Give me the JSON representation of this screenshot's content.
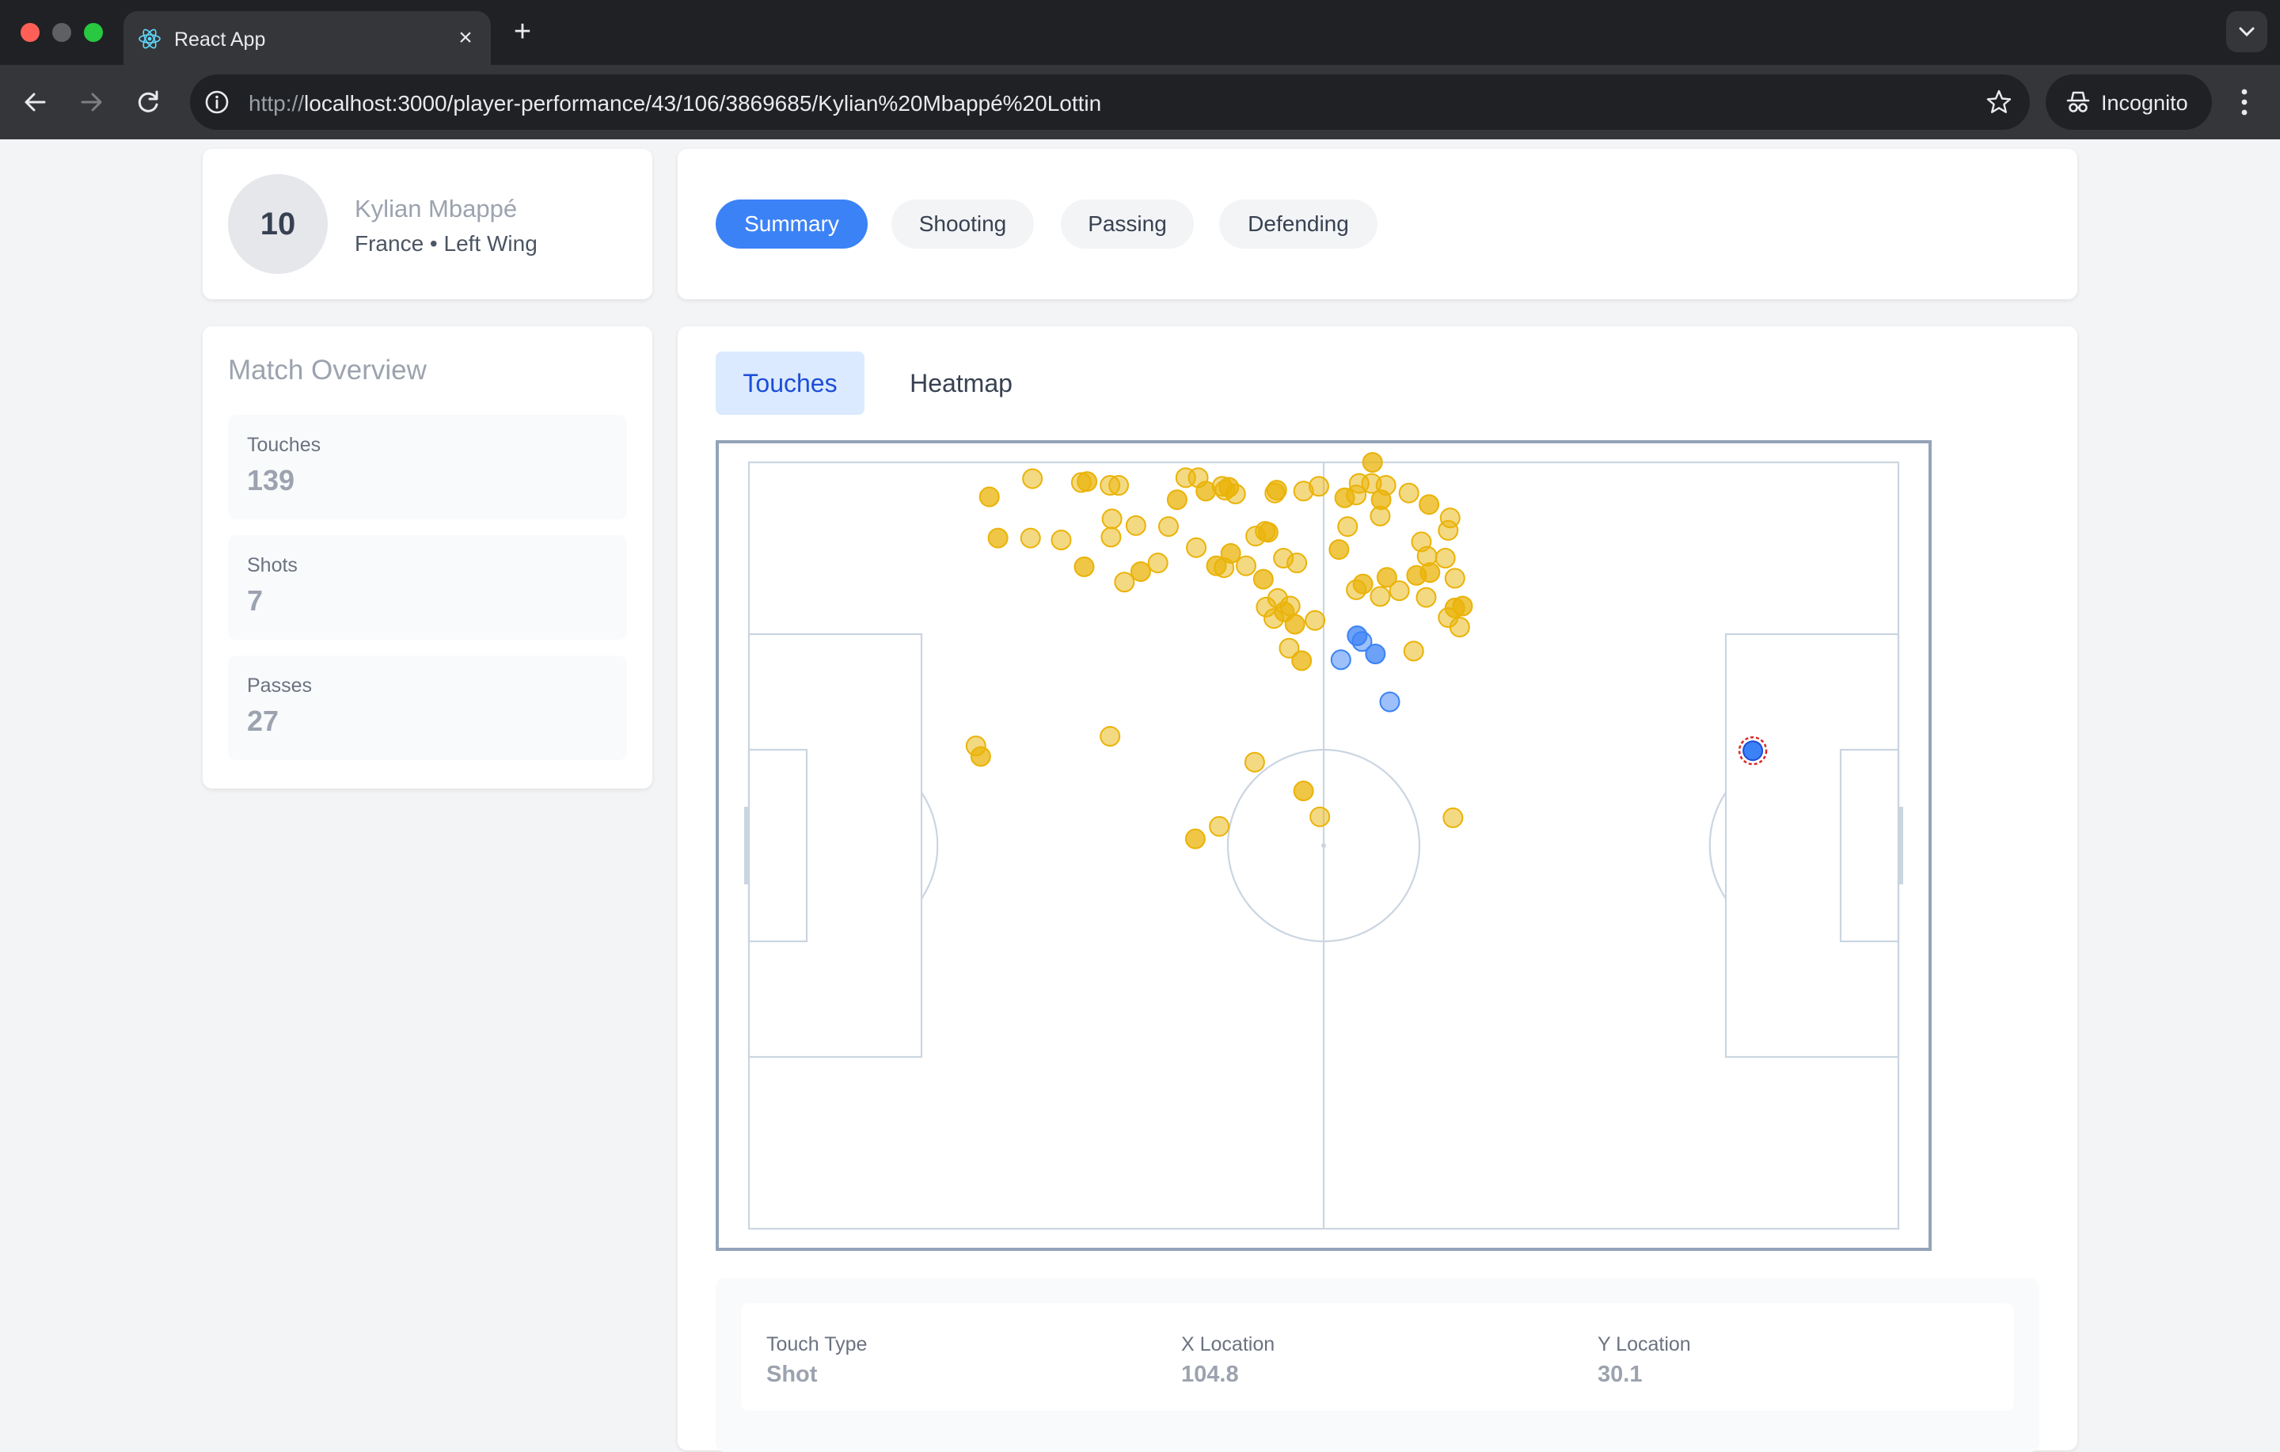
{
  "browser": {
    "tab_title": "React App",
    "url_prefix": "http://",
    "url_host": "localhost",
    "url_rest": ":3000/player-performance/43/106/3869685/Kylian%20Mbappé%20Lottin",
    "incognito_label": "Incognito"
  },
  "player": {
    "number": "10",
    "name": "Kylian Mbappé",
    "meta": "France • Left Wing"
  },
  "main_tabs": [
    "Summary",
    "Shooting",
    "Passing",
    "Defending"
  ],
  "active_main_tab": "Summary",
  "overview": {
    "title": "Match Overview",
    "stats": [
      {
        "label": "Touches",
        "value": "139"
      },
      {
        "label": "Shots",
        "value": "7"
      },
      {
        "label": "Passes",
        "value": "27"
      }
    ]
  },
  "viz_tabs": [
    "Touches",
    "Heatmap"
  ],
  "active_viz_tab": "Touches",
  "colors": {
    "accent": "#3b82f6",
    "touch": "#eab308",
    "shot": "#3b82f6",
    "selected_ring": "#dc2626"
  },
  "chart_data": {
    "type": "scatter",
    "pitch_length": 120,
    "pitch_width": 80,
    "series": [
      {
        "kind": "touch",
        "points": [
          [
            25.1,
            3.6
          ],
          [
            29.6,
            1.7
          ],
          [
            34.7,
            2.1
          ],
          [
            35.3,
            2.0
          ],
          [
            37.7,
            2.4
          ],
          [
            38.6,
            2.4
          ],
          [
            44.7,
            3.9
          ],
          [
            45.6,
            1.6
          ],
          [
            46.9,
            1.6
          ],
          [
            47.7,
            3.0
          ],
          [
            49.4,
            2.5
          ],
          [
            49.7,
            2.9
          ],
          [
            50.1,
            2.6
          ],
          [
            50.8,
            3.3
          ],
          [
            54.9,
            3.2
          ],
          [
            55.1,
            2.9
          ],
          [
            57.9,
            3.0
          ],
          [
            59.5,
            2.5
          ],
          [
            62.2,
            3.7
          ],
          [
            63.4,
            3.4
          ],
          [
            63.7,
            2.2
          ],
          [
            65.1,
            0.0
          ],
          [
            65.0,
            2.2
          ],
          [
            65.9,
            5.6
          ],
          [
            54.2,
            7.3
          ],
          [
            37.9,
            5.9
          ],
          [
            43.8,
            6.7
          ],
          [
            26.0,
            7.9
          ],
          [
            29.4,
            7.9
          ],
          [
            32.6,
            8.1
          ],
          [
            35.0,
            10.9
          ],
          [
            37.8,
            7.8
          ],
          [
            40.4,
            6.6
          ],
          [
            50.3,
            9.5
          ],
          [
            52.9,
            7.7
          ],
          [
            55.8,
            10.0
          ],
          [
            61.6,
            9.1
          ],
          [
            53.9,
            7.2
          ],
          [
            46.7,
            8.9
          ],
          [
            48.8,
            10.8
          ],
          [
            39.2,
            12.5
          ],
          [
            42.7,
            10.5
          ],
          [
            40.9,
            11.4
          ],
          [
            49.6,
            11.0
          ],
          [
            51.9,
            10.8
          ],
          [
            53.7,
            12.2
          ],
          [
            54.0,
            15.1
          ],
          [
            55.2,
            14.2
          ],
          [
            55.9,
            15.6
          ],
          [
            56.5,
            15.0
          ],
          [
            54.8,
            16.3
          ],
          [
            57.0,
            16.9
          ],
          [
            59.1,
            16.5
          ],
          [
            63.4,
            13.3
          ],
          [
            64.1,
            12.7
          ],
          [
            65.9,
            14.0
          ],
          [
            67.9,
            13.4
          ],
          [
            71.1,
            11.5
          ],
          [
            73.7,
            12.1
          ],
          [
            74.2,
            17.2
          ],
          [
            73.7,
            15.2
          ],
          [
            73.0,
            16.2
          ],
          [
            69.4,
            19.7
          ],
          [
            57.7,
            20.7
          ],
          [
            56.4,
            19.4
          ],
          [
            73.0,
            7.1
          ],
          [
            71.0,
            4.4
          ],
          [
            68.9,
            3.2
          ],
          [
            72.7,
            10.0
          ],
          [
            74.5,
            15.0
          ],
          [
            70.2,
            8.3
          ],
          [
            70.8,
            9.8
          ],
          [
            69.7,
            11.8
          ],
          [
            73.2,
            5.8
          ],
          [
            66.5,
            2.4
          ],
          [
            66.0,
            3.9
          ],
          [
            62.5,
            6.7
          ],
          [
            57.2,
            10.5
          ],
          [
            66.6,
            12.0
          ],
          [
            70.7,
            14.1
          ],
          [
            23.7,
            29.6
          ],
          [
            24.2,
            30.7
          ],
          [
            37.7,
            28.6
          ],
          [
            52.8,
            31.3
          ],
          [
            57.9,
            34.3
          ],
          [
            59.6,
            37.0
          ],
          [
            49.1,
            38.0
          ],
          [
            46.6,
            39.3
          ],
          [
            73.5,
            37.1
          ]
        ]
      },
      {
        "kind": "shot",
        "points": [
          [
            63.5,
            18.1
          ],
          [
            64.0,
            18.7
          ],
          [
            61.8,
            20.6
          ],
          [
            65.4,
            20.0
          ],
          [
            66.9,
            25.0
          ]
        ]
      }
    ],
    "selected": {
      "touch_type": "Shot",
      "x": 104.8,
      "y": 30.1
    }
  },
  "info": {
    "touch_type_label": "Touch Type",
    "touch_type_value": "Shot",
    "x_label": "X Location",
    "x_value": "104.8",
    "y_label": "Y Location",
    "y_value": "30.1"
  }
}
